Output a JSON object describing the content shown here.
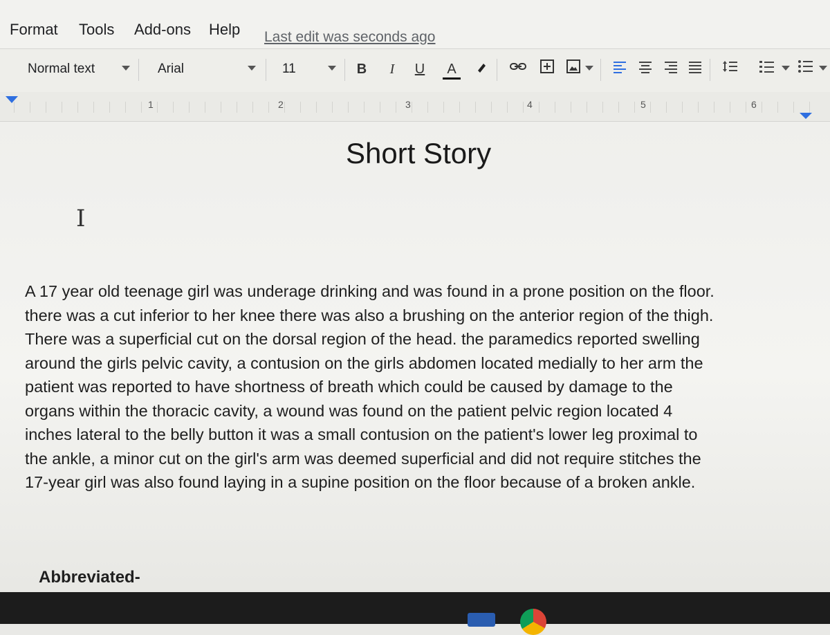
{
  "menu": {
    "items": [
      "Format",
      "Tools",
      "Add-ons",
      "Help"
    ],
    "last_edit": "Last edit was seconds ago"
  },
  "toolbar": {
    "style": "Normal text",
    "font": "Arial",
    "size": "11",
    "bold": "B",
    "italic": "I",
    "underline": "U",
    "text_color": "A"
  },
  "ruler": {
    "numbers": [
      "1",
      "2",
      "3",
      "4",
      "5",
      "6"
    ]
  },
  "document": {
    "title": "Short Story",
    "lines": [
      "A 17 year old teenage girl was underage drinking and was found in a prone position on the floor.",
      "there was a cut inferior to her knee there was also a brushing on the anterior region of the thigh.",
      "There was a superficial cut on the dorsal region of the head.  the paramedics reported swelling",
      "around the girls pelvic cavity, a contusion on the girls abdomen located medially to her arm the",
      "patient was reported to have shortness of breath which could be caused by damage to the",
      "organs within the thoracic cavity, a wound was found on the patient pelvic region located 4",
      "inches lateral to the belly button it was a small contusion on the patient's lower leg proximal to",
      "the ankle, a minor cut on the girl's arm was deemed superficial and did not require stitches the",
      "17-year girl was also found laying in a supine position on the floor because of a broken ankle."
    ],
    "footer_label": "Abbreviated-"
  },
  "colors": {
    "accent": "#2f6fe0"
  }
}
